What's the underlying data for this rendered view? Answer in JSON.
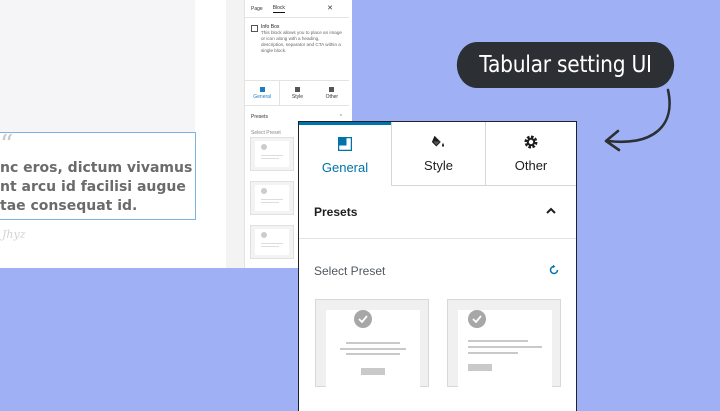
{
  "background_editor": {
    "quote_lines": [
      "nc eros, dictum vivamus",
      "nt arcu id facilisi augue",
      "tae consequat id."
    ],
    "sidebar": {
      "tabs": [
        "Page",
        "Block"
      ],
      "close": "✕",
      "block_title": "Info Box",
      "block_description": "This block allows you to place an image or icon along with a heading, description, separator and CTA within a single block.",
      "tab_labels": [
        "General",
        "Style",
        "Other"
      ],
      "presets_label": "Presets",
      "select_preset_label": "Select Preset"
    }
  },
  "panel": {
    "tabs": [
      {
        "label": "General",
        "icon": "layout-icon",
        "active": true
      },
      {
        "label": "Style",
        "icon": "paint-bucket-icon",
        "active": false
      },
      {
        "label": "Other",
        "icon": "gear-icon",
        "active": false
      }
    ],
    "presets_section": {
      "title": "Presets",
      "expanded": true,
      "toggle_icon": "chevron-up-icon"
    },
    "select_preset": {
      "label": "Select Preset",
      "reset_icon": "reset-icon"
    },
    "preset_cards": [
      {
        "icon": "check-icon"
      },
      {
        "icon": "check-icon"
      }
    ]
  },
  "callout": {
    "text": "Tabular setting UI"
  },
  "colors": {
    "accent": "#0073aa",
    "background": "#9fb1f4",
    "callout_bg": "#2c2f33"
  }
}
